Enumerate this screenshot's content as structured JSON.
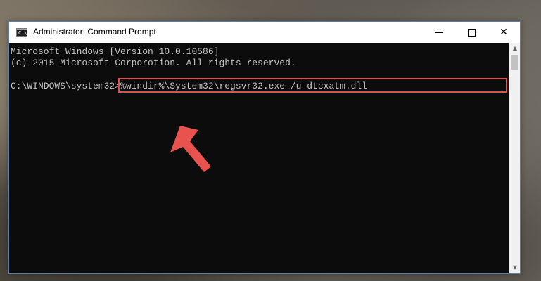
{
  "window": {
    "title": "Administrator: Command Prompt",
    "icon": "cmd-icon",
    "icon_text": "C:\\"
  },
  "controls": {
    "minimize": "minimize-icon",
    "maximize": "maximize-icon",
    "close": "close-icon",
    "close_glyph": "✕"
  },
  "console": {
    "line1": "Microsoft Windows [Version 10.0.10586]",
    "line2": "(c) 2015 Microsoft Corporotion. All rights reserved.",
    "prompt": "C:\\WINDOWS\\system32>",
    "command": "%windir%\\System32\\regsvr32.exe /u dtcxatm.dll"
  },
  "annotation": {
    "highlight_color": "#d9534f",
    "arrow_color": "#e8534f"
  },
  "scrollbar": {
    "up_glyph": "▲",
    "down_glyph": "▼"
  }
}
